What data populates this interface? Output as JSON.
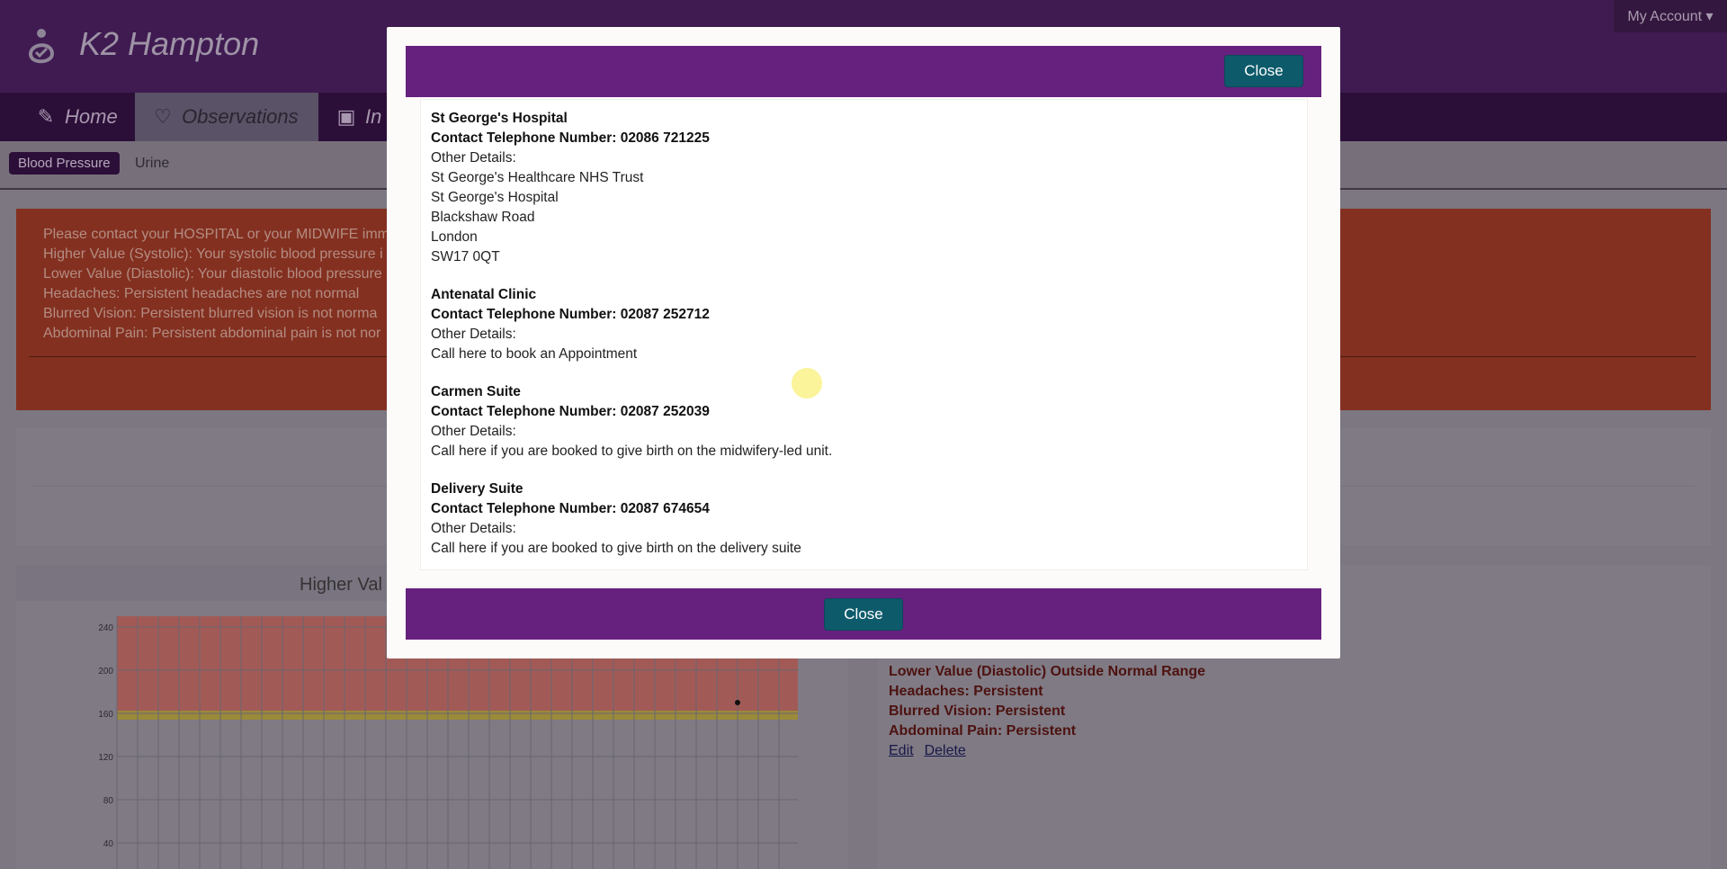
{
  "app": {
    "brand": "K2 Hampton",
    "account_label": "My Account ▾"
  },
  "nav": {
    "tabs": [
      {
        "label": "Home",
        "icon": "edit-icon"
      },
      {
        "label": "Observations",
        "icon": "heart-icon"
      },
      {
        "label": "In",
        "icon": "book-icon"
      }
    ]
  },
  "subnav": {
    "active": "Blood Pressure",
    "other": "Urine"
  },
  "alert": {
    "lines": [
      "Please contact your HOSPITAL or your MIDWIFE imm",
      "Higher Value (Systolic): Your systolic blood pressure i",
      "Lower Value (Diastolic): Your diastolic blood pressure",
      "Headaches: Persistent headaches are not normal",
      "Blurred Vision: Persistent blurred vision is not norma",
      "Abdominal Pain: Persistent abdominal pain is not nor"
    ]
  },
  "chart": {
    "title": "Higher Val",
    "y_ticks": [
      "240",
      "200",
      "160",
      "120",
      "80",
      "40"
    ]
  },
  "observation": {
    "statuses": [
      "Lower Value (Diastolic) Outside Normal Range",
      "Headaches: Persistent",
      "Blurred Vision: Persistent",
      "Abdominal Pain: Persistent"
    ],
    "edit_label": "Edit",
    "delete_label": "Delete"
  },
  "modal": {
    "close_label": "Close",
    "contacts": [
      {
        "name": "St George's Hospital",
        "tel": "Contact Telephone Number: 02086 721225",
        "details_label": "Other Details:",
        "details": [
          "St George's Healthcare NHS Trust",
          "St George's Hospital",
          "Blackshaw Road",
          "London",
          "SW17 0QT"
        ]
      },
      {
        "name": "Antenatal Clinic",
        "tel": "Contact Telephone Number: 02087 252712",
        "details_label": "Other Details:",
        "details": [
          "Call here to book an Appointment"
        ]
      },
      {
        "name": "Carmen Suite",
        "tel": "Contact Telephone Number: 02087 252039",
        "details_label": "Other Details:",
        "details": [
          "Call here if you are booked to give birth on the midwifery-led unit."
        ]
      },
      {
        "name": "Delivery Suite",
        "tel": "Contact Telephone Number: 02087 674654",
        "details_label": "Other Details:",
        "details": [
          "Call here if you are booked to give birth on the delivery suite"
        ]
      }
    ]
  }
}
